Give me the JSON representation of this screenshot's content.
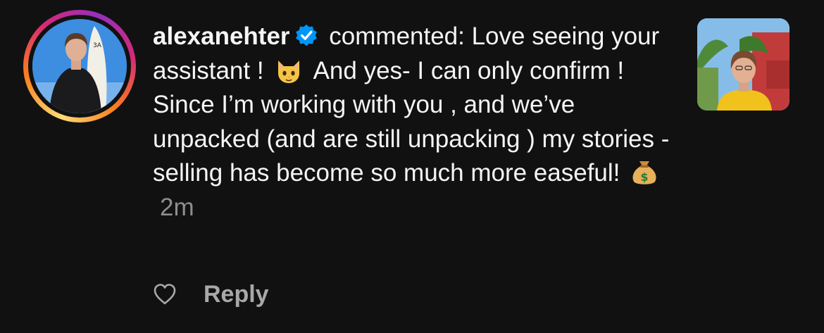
{
  "comment": {
    "username": "alexanehter",
    "verified": true,
    "text_before_emoji_1": " commented: Love seeing your assistant !",
    "emoji_1": "cat-face-emoji",
    "text_middle": "And yes- I can only confirm ! Since I’m working with you , and we’ve unpacked (and are still unpacking ) my stories - selling has become so much more easeful!",
    "emoji_2": "money-bag-emoji",
    "timestamp": "2m"
  },
  "actions": {
    "like_icon": "heart-icon",
    "reply_label": "Reply"
  },
  "colors": {
    "background": "#111111",
    "text": "#f5f5f5",
    "muted": "#8e8e8e",
    "verified_blue": "#0095f6",
    "reply_gray": "#a8a8a8"
  }
}
